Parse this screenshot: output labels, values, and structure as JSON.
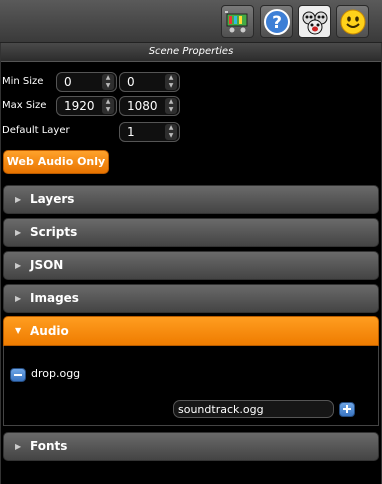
{
  "toolbar": {
    "icons": [
      "cart-icon",
      "help-icon",
      "monsters-icon",
      "smiley-icon"
    ]
  },
  "panel": {
    "title": "Scene Properties",
    "min_size": {
      "label": "Min Size",
      "width": "0",
      "height": "0"
    },
    "max_size": {
      "label": "Max Size",
      "width": "1920",
      "height": "1080"
    },
    "default_layer": {
      "label": "Default Layer",
      "value": "1"
    },
    "web_audio_button": "Web Audio Only"
  },
  "sections": [
    {
      "label": "Layers",
      "expanded": false
    },
    {
      "label": "Scripts",
      "expanded": false
    },
    {
      "label": "JSON",
      "expanded": false
    },
    {
      "label": "Images",
      "expanded": false
    },
    {
      "label": "Audio",
      "expanded": true
    },
    {
      "label": "Fonts",
      "expanded": false
    }
  ],
  "audio": {
    "files": [
      "drop.ogg"
    ],
    "new_file_value": "soundtrack.ogg"
  },
  "colors": {
    "accent": "#f58a0b",
    "section_bg": "#555555",
    "button_blue": "#4f8ad6"
  }
}
